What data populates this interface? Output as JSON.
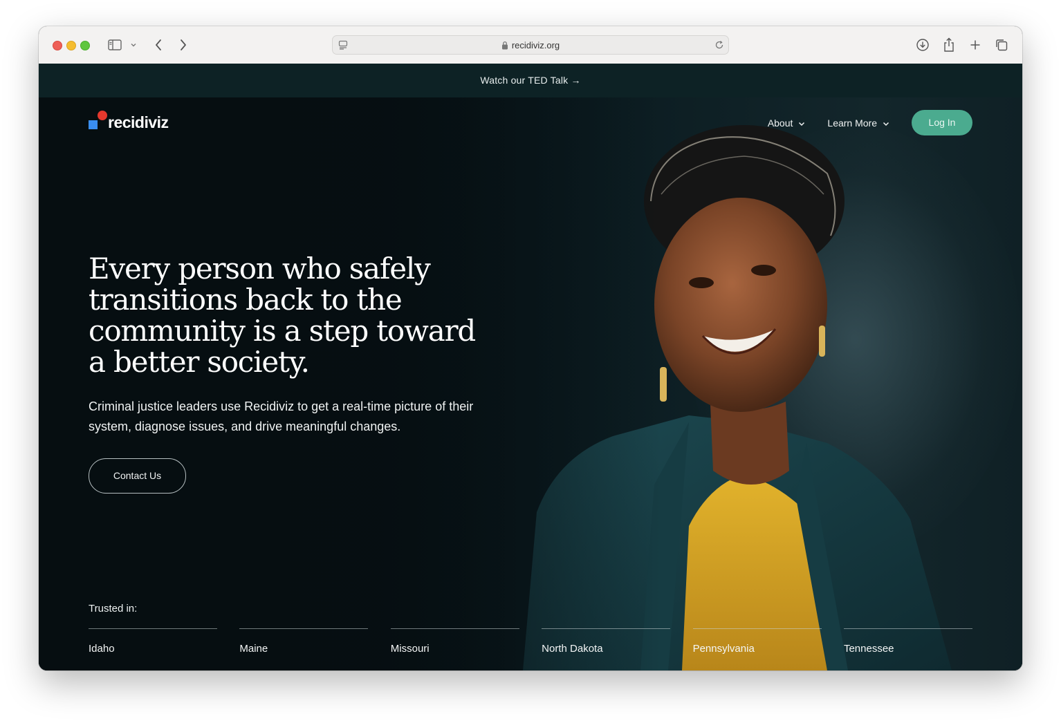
{
  "browser": {
    "url": "recidiviz.org",
    "icons": {
      "sidebar": "sidebar-icon",
      "back": "chevron-left-icon",
      "forward": "chevron-right-icon",
      "download": "download-icon",
      "share": "share-icon",
      "new_tab": "plus-icon",
      "tabs": "tabs-overview-icon",
      "reload": "reload-icon",
      "lock": "lock-icon",
      "reader": "reader-icon"
    }
  },
  "banner": {
    "text": "Watch our TED Talk →"
  },
  "header": {
    "logo_text": "recidiviz",
    "nav": [
      {
        "label": "About"
      },
      {
        "label": "Learn More"
      }
    ],
    "login_label": "Log In"
  },
  "hero": {
    "headline": "Every person who safely transitions back to the community is a step toward a better society.",
    "subtext": "Criminal justice leaders use Recidiviz to get a real-time picture of their system, diagnose issues, and drive meaningful changes.",
    "cta_label": "Contact Us"
  },
  "trusted": {
    "label": "Trusted in:",
    "states": [
      "Idaho",
      "Maine",
      "Missouri",
      "North Dakota",
      "Pennsylvania",
      "Tennessee"
    ]
  },
  "colors": {
    "banner_bg": "#0d2225",
    "login_bg": "#4bab8f",
    "logo_square": "#3a8ef0",
    "logo_dot": "#e4382d",
    "jacket": "#1d4a52",
    "blouse": "#d9a520"
  }
}
